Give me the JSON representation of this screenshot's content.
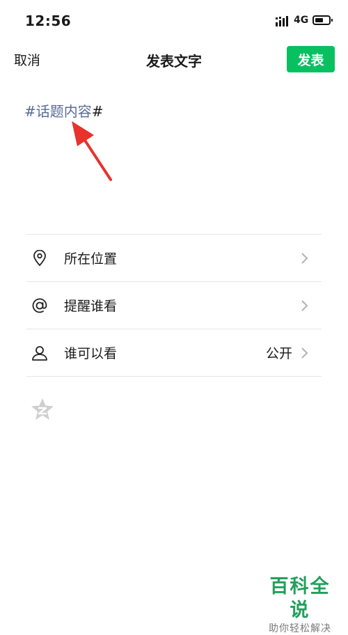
{
  "status_bar": {
    "time": "12:56",
    "network": "4G"
  },
  "nav": {
    "cancel_label": "取消",
    "title": "发表文字",
    "publish_label": "发表"
  },
  "compose": {
    "topic_text": "#话题内容",
    "hash_end": "#"
  },
  "options": [
    {
      "label": "所在位置",
      "value": "",
      "icon": "location-pin-icon"
    },
    {
      "label": "提醒谁看",
      "value": "",
      "icon": "at-sign-icon"
    },
    {
      "label": "谁可以看",
      "value": "公开",
      "icon": "person-icon"
    }
  ],
  "watermark": {
    "title": "百科全说",
    "subtitle": "助你轻松解决"
  },
  "colors": {
    "accent_green": "#07c160",
    "topic_blue": "#576b95",
    "arrow_red": "#e8322c"
  }
}
